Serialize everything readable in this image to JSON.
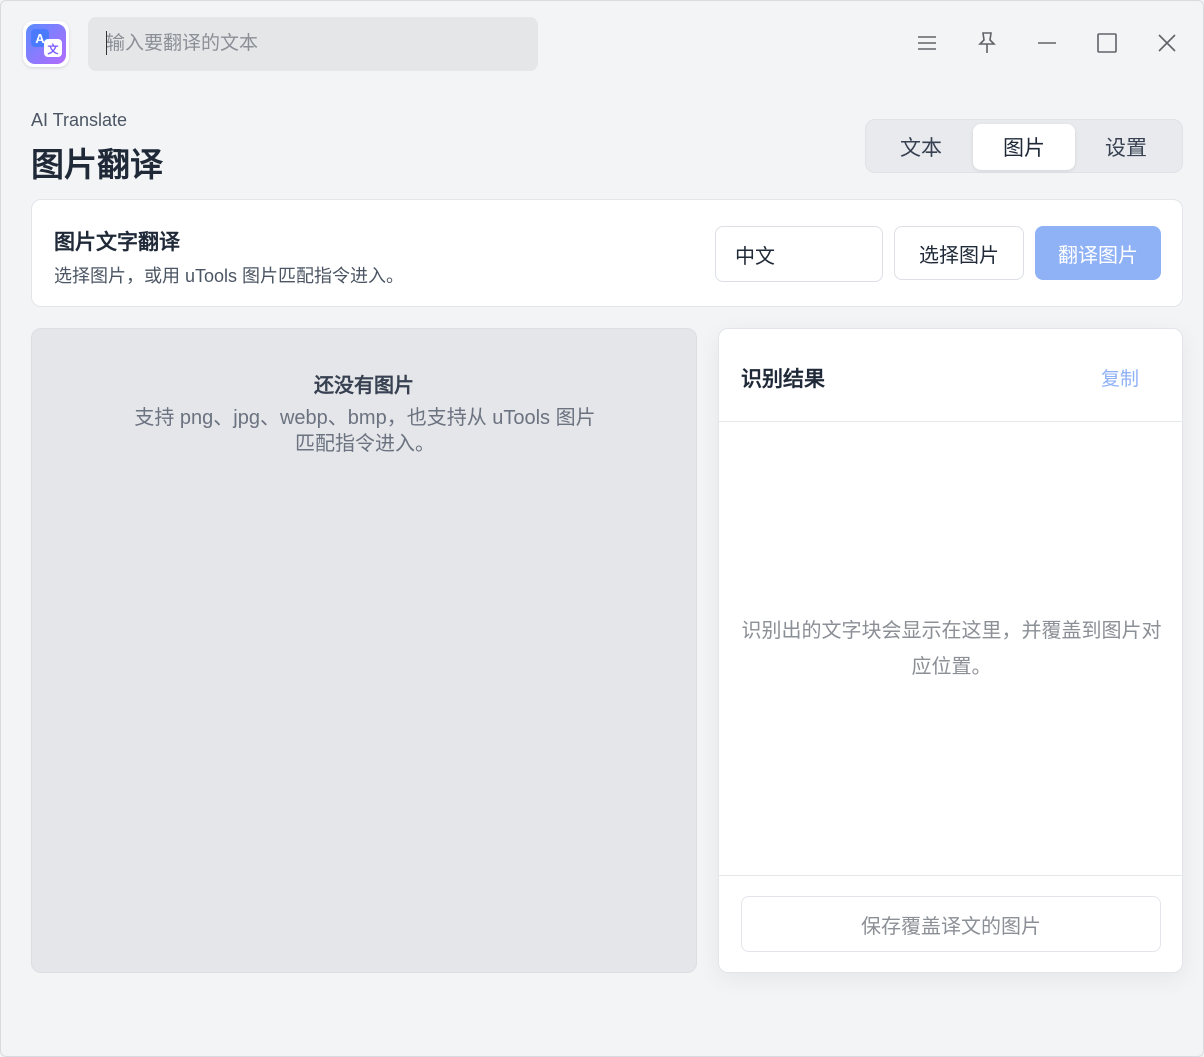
{
  "titlebar": {
    "logo_icon": "translate-app-icon",
    "search_placeholder": "输入要翻译的文本",
    "controls": [
      "menu-icon",
      "pin-icon",
      "minimize-icon",
      "maximize-icon",
      "close-icon"
    ]
  },
  "header": {
    "app_name": "AI Translate",
    "page_title": "图片翻译",
    "tabs": [
      {
        "label": "文本",
        "active": false
      },
      {
        "label": "图片",
        "active": true
      },
      {
        "label": "设置",
        "active": false
      }
    ]
  },
  "toolbar": {
    "title": "图片文字翻译",
    "description": "选择图片，或用 uTools 图片匹配指令进入。",
    "target_language": "中文",
    "choose_image_label": "选择图片",
    "translate_label": "翻译图片"
  },
  "image_pane": {
    "empty_title": "还没有图片",
    "empty_description": "支持 png、jpg、webp、bmp，也支持从 uTools 图片匹配指令进入。"
  },
  "result": {
    "title": "识别结果",
    "copy_label": "复制",
    "placeholder": "识别出的文字块会显示在这里，并覆盖到图片对应位置。",
    "save_label": "保存覆盖译文的图片"
  },
  "colors": {
    "accent": "#8fb1f6",
    "background": "#f3f4f6"
  }
}
